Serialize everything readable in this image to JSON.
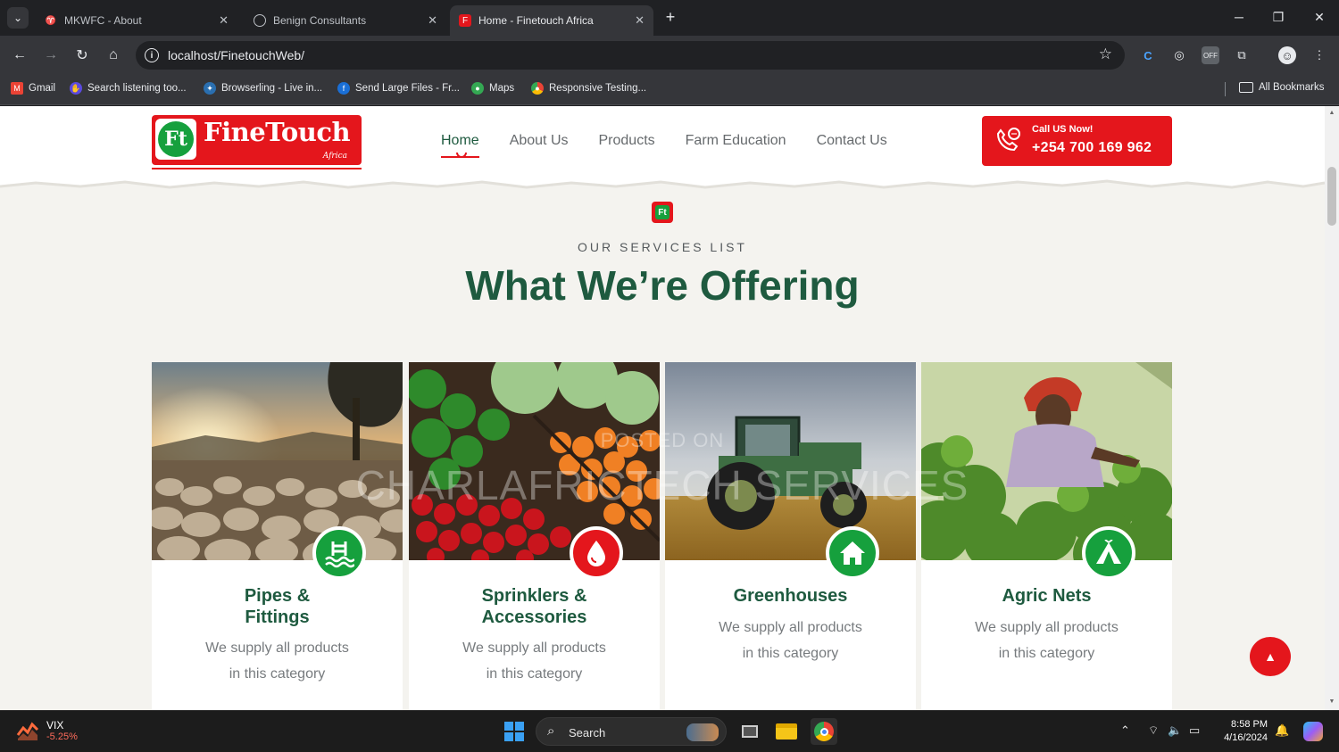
{
  "browser": {
    "tabs": [
      {
        "title": "MKWFC - About",
        "active": false
      },
      {
        "title": "Benign Consultants",
        "active": false
      },
      {
        "title": "Home - Finetouch Africa",
        "active": true
      }
    ],
    "url": "localhost/FinetouchWeb/",
    "bookmarks": [
      {
        "label": "Gmail"
      },
      {
        "label": "Search listening too..."
      },
      {
        "label": "Browserling - Live in..."
      },
      {
        "label": "Send Large Files - Fr..."
      },
      {
        "label": "Maps"
      },
      {
        "label": "Responsive Testing..."
      }
    ],
    "all_bookmarks": "All Bookmarks"
  },
  "site": {
    "logo_text": "FineTouch",
    "logo_sub": "Africa",
    "logo_mark": "Ft",
    "nav": [
      {
        "label": "Home",
        "active": true
      },
      {
        "label": "About Us"
      },
      {
        "label": "Products"
      },
      {
        "label": "Farm Education"
      },
      {
        "label": "Contact Us"
      }
    ],
    "call": {
      "label": "Call US Now!",
      "number": "+254 700 169 962"
    }
  },
  "section": {
    "eyebrow": "OUR SERVICES LIST",
    "title": "What We’re Offering",
    "watermark_line1": "POSTED ON",
    "watermark_line2": "CHARLAFRICTECH SERVICES"
  },
  "cards": [
    {
      "title_line1": "Pipes &",
      "title_line2": "Fittings",
      "desc_line1": "We supply all products",
      "desc_line2": "in this category",
      "badge_color": "#16a03d",
      "icon": "pool-icon"
    },
    {
      "title_line1": "Sprinklers &",
      "title_line2": "Accessories",
      "desc_line1": "We supply all products",
      "desc_line2": "in this category",
      "badge_color": "#e4161c",
      "icon": "water-drop-icon"
    },
    {
      "title_line1": "Greenhouses",
      "title_line2": "",
      "desc_line1": "We supply all products",
      "desc_line2": "in this category",
      "badge_color": "#16a03d",
      "icon": "house-icon"
    },
    {
      "title_line1": "Agric Nets",
      "title_line2": "",
      "desc_line1": "We supply all products",
      "desc_line2": "in this category",
      "badge_color": "#16a03d",
      "icon": "tent-icon"
    }
  ],
  "taskbar": {
    "widget_name": "VIX",
    "widget_value": "-5.25%",
    "search_label": "Search",
    "time": "8:58 PM",
    "date": "4/16/2024"
  },
  "colors": {
    "brand_red": "#e4161c",
    "brand_green": "#16a03d",
    "heading_green": "#1e5a3f"
  }
}
